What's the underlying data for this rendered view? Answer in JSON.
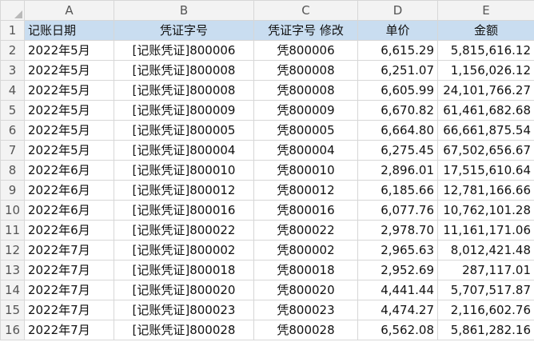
{
  "columns": [
    "A",
    "B",
    "C",
    "D",
    "E"
  ],
  "header_row": {
    "num": "1",
    "cells": [
      "记账日期",
      "凭证字号",
      "凭证字号 修改",
      "单价",
      "金额"
    ]
  },
  "rows": [
    {
      "num": "2",
      "cells": [
        "2022年5月",
        "[记账凭证]800006",
        "凭800006",
        "6,615.29",
        "5,815,616.12"
      ]
    },
    {
      "num": "3",
      "cells": [
        "2022年5月",
        "[记账凭证]800008",
        "凭800008",
        "6,251.07",
        "1,156,026.12"
      ]
    },
    {
      "num": "4",
      "cells": [
        "2022年5月",
        "[记账凭证]800008",
        "凭800008",
        "6,605.99",
        "24,101,766.27"
      ]
    },
    {
      "num": "5",
      "cells": [
        "2022年5月",
        "[记账凭证]800009",
        "凭800009",
        "6,670.82",
        "61,461,682.68"
      ]
    },
    {
      "num": "6",
      "cells": [
        "2022年5月",
        "[记账凭证]800005",
        "凭800005",
        "6,664.80",
        "66,661,875.54"
      ]
    },
    {
      "num": "7",
      "cells": [
        "2022年5月",
        "[记账凭证]800004",
        "凭800004",
        "6,275.45",
        "67,502,656.67"
      ]
    },
    {
      "num": "8",
      "cells": [
        "2022年6月",
        "[记账凭证]800010",
        "凭800010",
        "2,896.01",
        "17,515,610.64"
      ]
    },
    {
      "num": "9",
      "cells": [
        "2022年6月",
        "[记账凭证]800012",
        "凭800012",
        "6,185.66",
        "12,781,166.66"
      ]
    },
    {
      "num": "10",
      "cells": [
        "2022年6月",
        "[记账凭证]800016",
        "凭800016",
        "6,077.76",
        "10,762,101.28"
      ]
    },
    {
      "num": "11",
      "cells": [
        "2022年6月",
        "[记账凭证]800022",
        "凭800022",
        "2,978.70",
        "11,161,171.06"
      ]
    },
    {
      "num": "12",
      "cells": [
        "2022年7月",
        "[记账凭证]800002",
        "凭800002",
        "2,965.63",
        "8,012,421.48"
      ]
    },
    {
      "num": "13",
      "cells": [
        "2022年7月",
        "[记账凭证]800018",
        "凭800018",
        "2,952.69",
        "287,117.01"
      ]
    },
    {
      "num": "14",
      "cells": [
        "2022年7月",
        "[记账凭证]800020",
        "凭800020",
        "4,441.44",
        "5,707,517.87"
      ]
    },
    {
      "num": "15",
      "cells": [
        "2022年7月",
        "[记账凭证]800023",
        "凭800023",
        "4,474.27",
        "2,116,602.76"
      ]
    },
    {
      "num": "16",
      "cells": [
        "2022年7月",
        "[记账凭证]800028",
        "凭800028",
        "6,562.08",
        "5,861,282.16"
      ]
    }
  ]
}
